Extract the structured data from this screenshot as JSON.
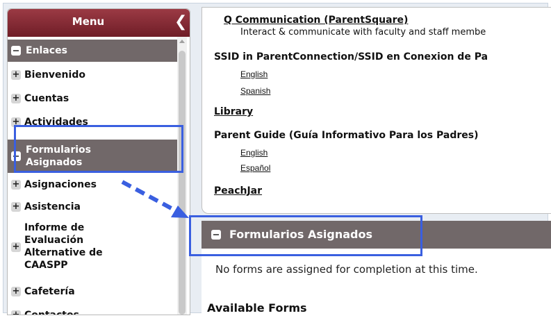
{
  "sidebar": {
    "title": "Menu",
    "collapse_glyph": "❮",
    "items": [
      {
        "label": "Enlaces",
        "state": "expanded"
      },
      {
        "label": "Bienvenido",
        "state": "collapsed"
      },
      {
        "label": "Cuentas",
        "state": "collapsed"
      },
      {
        "label": "Actividades",
        "state": "collapsed"
      },
      {
        "label": "Formularios Asignados",
        "state": "expanded"
      },
      {
        "label": "Asignaciones",
        "state": "collapsed"
      },
      {
        "label": "Asistencia",
        "state": "collapsed"
      },
      {
        "label": "Informe de Evaluación Alternative de CAASPP",
        "state": "collapsed"
      },
      {
        "label": "Cafetería",
        "state": "collapsed"
      },
      {
        "label": "Contactos",
        "state": "collapsed"
      }
    ]
  },
  "links": {
    "q_comm": {
      "title": "Q Communication (ParentSquare)",
      "desc": "Interact & communicate with faculty and staff membe"
    },
    "ssid": {
      "title": "SSID in ParentConnection/SSID en Conexion de Pa",
      "english": "English",
      "spanish": "Spanish"
    },
    "library": "Library",
    "parent_guide": {
      "title": "Parent Guide (Guía Informativo Para los Padres)",
      "english": "English",
      "espanol": "Español"
    },
    "peachjar": "PeachJar"
  },
  "forms": {
    "header": "Formularios Asignados",
    "message": "No forms are assigned for completion at this time.",
    "available": "Available Forms"
  },
  "annotation": {
    "color": "#3a5fe0"
  }
}
